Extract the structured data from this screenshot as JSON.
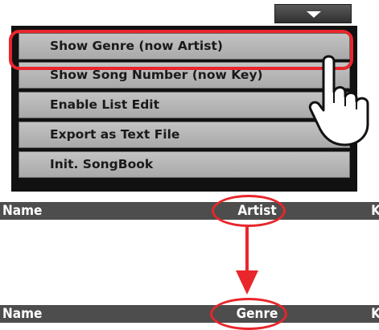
{
  "menu": {
    "items": [
      {
        "label": "Show Genre (now Artist)"
      },
      {
        "label": "Show Song Number (now Key)"
      },
      {
        "label": "Enable List Edit"
      },
      {
        "label": "Export as Text File"
      },
      {
        "label": "Init. SongBook"
      }
    ]
  },
  "column_header_before": {
    "name": "Name",
    "middle": "Artist",
    "right": "K"
  },
  "column_header_after": {
    "name": "Name",
    "middle": "Genre",
    "right": "K"
  },
  "icons": {
    "dropdown": "triangle-down-icon",
    "pointer": "pointing-hand-icon",
    "arrow": "arrow-down-icon"
  },
  "colors": {
    "highlight": "#e8262b",
    "menu_item_bg": "#b6b6b6",
    "header_bar_bg": "#4d4d4d"
  }
}
